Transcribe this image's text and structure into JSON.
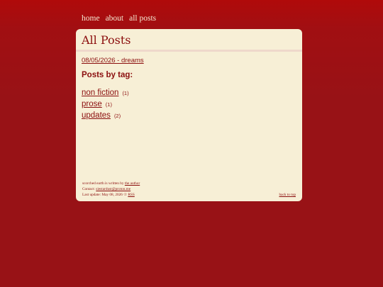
{
  "nav": {
    "home": "home",
    "about": "about",
    "all_posts": "all posts"
  },
  "page": {
    "title": "All Posts"
  },
  "posts": [
    {
      "label": "08/05/2026 - dreams"
    }
  ],
  "tags": {
    "heading": "Posts by tag:",
    "items": [
      {
        "name": "non fiction",
        "count": "(1)"
      },
      {
        "name": "prose",
        "count": "(1)"
      },
      {
        "name": "updates",
        "count": "(2)"
      }
    ]
  },
  "footer": {
    "written_by_prefix": "scorched earth is written by ",
    "author_link": "the author",
    "contact_prefix": "Contact: ",
    "contact_email": "siestardust@proton.me",
    "last_update": "Last update: May 08, 2026 ☉ ",
    "rss": "RSS",
    "back_to_top": "back to top"
  },
  "colors": {
    "background": "#981216",
    "card": "#f7efd6",
    "accent": "#8b0e0e",
    "nav_text": "#f6ead3"
  }
}
